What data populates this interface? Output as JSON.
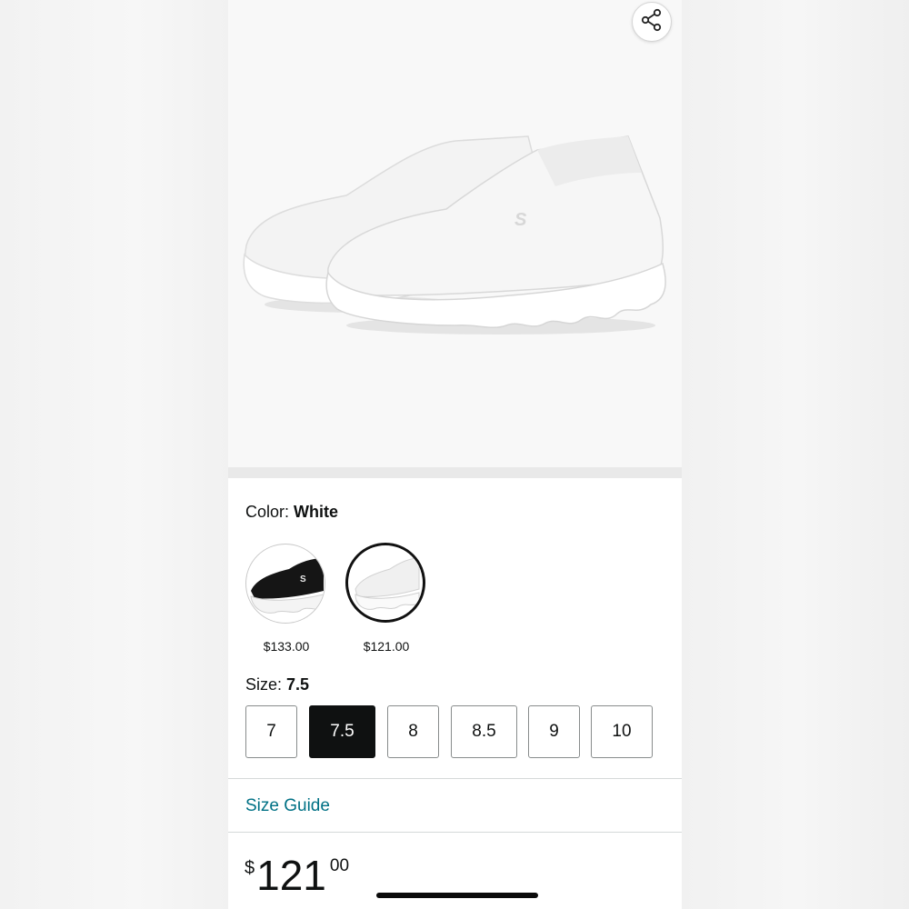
{
  "colors": {
    "accent_link": "#007185",
    "selected_size_bg": "#0f1111",
    "border": "#888c8c"
  },
  "hero": {
    "share_icon": "share-icon",
    "image": "white-slip-on-sneaker-pair"
  },
  "color_selector": {
    "label": "Color:",
    "selected_value": "White",
    "options": [
      {
        "image": "black-sneaker",
        "price": "$133.00",
        "selected": false
      },
      {
        "image": "white-sneaker",
        "price": "$121.00",
        "selected": true
      }
    ]
  },
  "size_selector": {
    "label": "Size:",
    "selected_value": "7.5",
    "options": [
      "7",
      "7.5",
      "8",
      "8.5",
      "9",
      "10"
    ]
  },
  "size_guide": {
    "label": "Size Guide"
  },
  "price": {
    "symbol": "$",
    "whole": "121",
    "fraction": "00"
  }
}
